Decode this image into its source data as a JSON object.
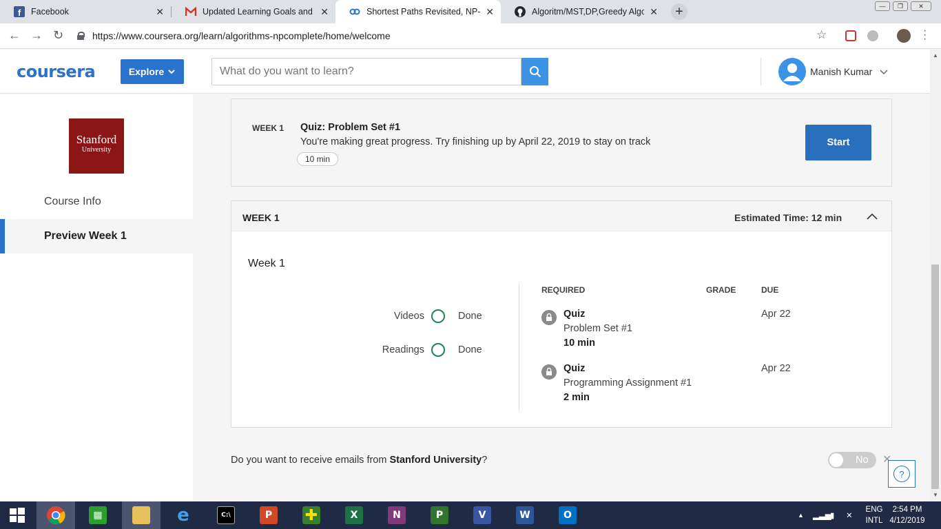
{
  "browser": {
    "tabs": [
      {
        "title": "Facebook",
        "icon": "facebook-icon",
        "color": "#3b5998"
      },
      {
        "title": "Updated Learning Goals and Tim",
        "icon": "gmail-icon",
        "color": "#d93025"
      },
      {
        "title": "Shortest Paths Revisited, NP-Com",
        "icon": "coursera-icon",
        "color": "#2a73cc"
      },
      {
        "title": "Algoritm/MST,DP,Greedy Algorit",
        "icon": "github-icon",
        "color": "#24292e"
      }
    ],
    "url": "https://www.coursera.org/learn/algorithms-npcomplete/home/welcome"
  },
  "header": {
    "logo": "coursera",
    "explore_label": "Explore",
    "search_placeholder": "What do you want to learn?",
    "user_name": "Manish Kumar",
    "brand_color": "#2a73cc"
  },
  "sidebar": {
    "university_line1": "Stanford",
    "university_line2": "University",
    "university_color": "#8c1515",
    "items": [
      {
        "label": "Course Info",
        "active": false
      },
      {
        "label": "Preview Week 1",
        "active": true
      }
    ]
  },
  "next_item": {
    "week": "WEEK 1",
    "title": "Quiz: Problem Set #1",
    "message": "You're making great progress. Try finishing up by April 22, 2019 to stay on track",
    "duration": "10 min",
    "button": "Start"
  },
  "week_section": {
    "header": "WEEK 1",
    "estimated_time": "Estimated Time: 12 min",
    "name": "Week 1",
    "progress": [
      {
        "label": "Videos",
        "status": "Done"
      },
      {
        "label": "Readings",
        "status": "Done"
      }
    ],
    "columns": {
      "required": "REQUIRED",
      "grade": "GRADE",
      "due": "DUE"
    },
    "items": [
      {
        "type": "Quiz",
        "name": "Problem Set #1",
        "duration": "10 min",
        "due": "Apr 22"
      },
      {
        "type": "Quiz",
        "name": "Programming Assignment #1",
        "duration": "2 min",
        "due": "Apr 22"
      }
    ]
  },
  "email_prompt": {
    "text_before": "Do you want to receive emails from ",
    "university": "Stanford University",
    "text_after": "?",
    "toggle_label": "No"
  },
  "taskbar": {
    "language_line1": "ENG",
    "language_line2": "INTL",
    "time": "2:54 PM",
    "date": "4/12/2019"
  }
}
